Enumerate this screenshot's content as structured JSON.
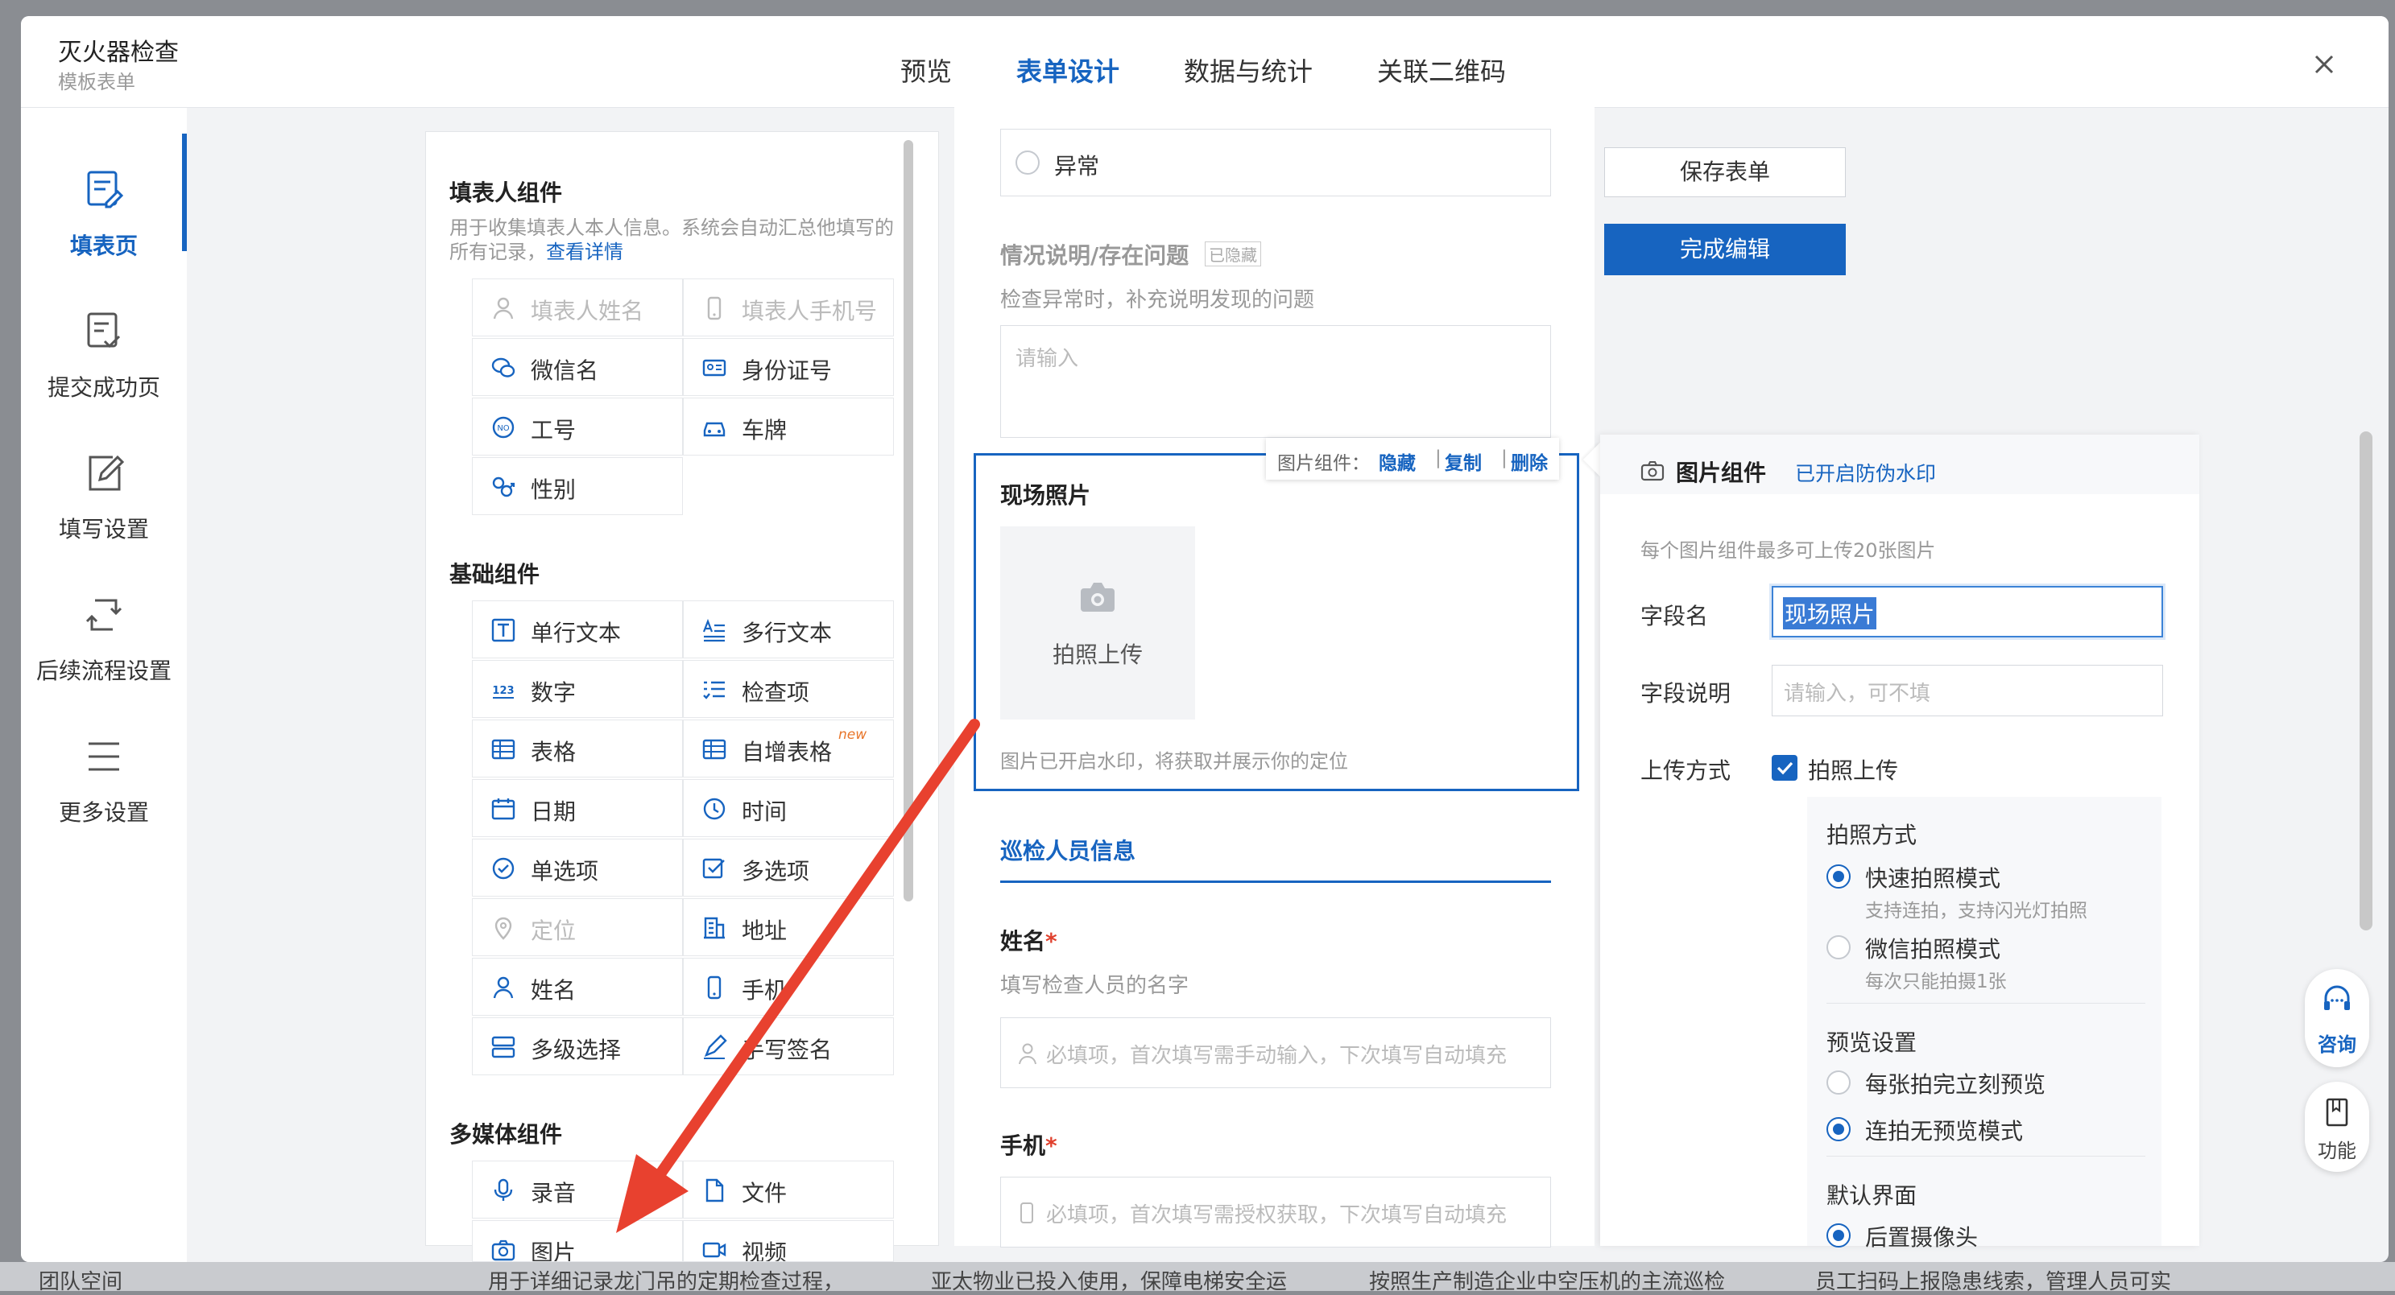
{
  "header": {
    "title": "灭火器检查",
    "subtitle": "模板表单",
    "tabs": [
      {
        "label": "预览",
        "active": false
      },
      {
        "label": "表单设计",
        "active": true
      },
      {
        "label": "数据与统计",
        "active": false
      },
      {
        "label": "关联二维码",
        "active": false
      }
    ],
    "close_icon": "close-icon"
  },
  "sidebar": {
    "items": [
      {
        "label": "填表页",
        "icon": "form-edit-icon",
        "active": true
      },
      {
        "label": "提交成功页",
        "icon": "submit-check-icon",
        "active": false
      },
      {
        "label": "填写设置",
        "icon": "pencil-square-icon",
        "active": false
      },
      {
        "label": "后续流程设置",
        "icon": "workflow-cycle-icon",
        "active": false
      },
      {
        "label": "更多设置",
        "icon": "menu-lines-icon",
        "active": false
      }
    ]
  },
  "palette": {
    "filler": {
      "title": "填表人组件",
      "desc": "用于收集填表人本人信息。系统会自动汇总他填写的所有记录，",
      "link": "查看详情",
      "items": [
        {
          "label": "填表人姓名",
          "disabled": true
        },
        {
          "label": "填表人手机号",
          "disabled": true
        },
        {
          "label": "微信名",
          "disabled": false
        },
        {
          "label": "身份证号",
          "disabled": false
        },
        {
          "label": "工号",
          "disabled": false
        },
        {
          "label": "车牌",
          "disabled": false
        },
        {
          "label": "性别",
          "disabled": false
        }
      ]
    },
    "basic": {
      "title": "基础组件",
      "items": [
        {
          "label": "单行文本",
          "disabled": false
        },
        {
          "label": "多行文本",
          "disabled": false
        },
        {
          "label": "数字",
          "disabled": false
        },
        {
          "label": "检查项",
          "disabled": false
        },
        {
          "label": "表格",
          "disabled": false
        },
        {
          "label": "自增表格",
          "disabled": false,
          "badge": "new"
        },
        {
          "label": "日期",
          "disabled": false
        },
        {
          "label": "时间",
          "disabled": false
        },
        {
          "label": "单选项",
          "disabled": false
        },
        {
          "label": "多选项",
          "disabled": false
        },
        {
          "label": "定位",
          "disabled": true
        },
        {
          "label": "地址",
          "disabled": false
        },
        {
          "label": "姓名",
          "disabled": false
        },
        {
          "label": "手机",
          "disabled": false
        },
        {
          "label": "多级选择",
          "disabled": false
        },
        {
          "label": "手写签名",
          "disabled": false
        }
      ]
    },
    "media": {
      "title": "多媒体组件",
      "items": [
        {
          "label": "录音",
          "disabled": false
        },
        {
          "label": "文件",
          "disabled": false
        },
        {
          "label": "图片",
          "disabled": false
        },
        {
          "label": "视频",
          "disabled": false
        }
      ]
    }
  },
  "form": {
    "abnormal_option": "异常",
    "situation": {
      "title": "情况说明/存在问题",
      "hidden_tag": "已隐藏",
      "desc": "检查异常时，补充说明发现的问题",
      "placeholder": "请输入"
    },
    "toolbar": {
      "prefix": "图片组件：",
      "hide": "隐藏",
      "copy": "复制",
      "delete": "删除"
    },
    "photo": {
      "title": "现场照片",
      "upload_label": "拍照上传",
      "watermark_note": "图片已开启水印，将获取并展示你的定位"
    },
    "inspector_section": "巡检人员信息",
    "name": {
      "title": "姓名",
      "required_mark": "*",
      "desc": "填写检查人员的名字",
      "placeholder": "必填项，首次填写需手动输入，下次填写自动填充"
    },
    "phone": {
      "title": "手机",
      "required_mark": "*",
      "placeholder": "必填项，首次填写需授权获取，下次填写自动填充"
    }
  },
  "actions": {
    "save": "保存表单",
    "finish": "完成编辑"
  },
  "props": {
    "title": "图片组件",
    "watermark_status": "已开启防伪水印",
    "limit_note": "每个图片组件最多可上传20张图片",
    "field_name_label": "字段名",
    "field_name_value": "现场照片",
    "field_desc_label": "字段说明",
    "field_desc_placeholder": "请输入，可不填",
    "upload_method_label": "上传方式",
    "upload_method_option": "拍照上传",
    "upload_method_checked": true,
    "shoot_mode": {
      "title": "拍照方式",
      "options": [
        {
          "label": "快速拍照模式",
          "hint": "支持连拍，支持闪光灯拍照",
          "selected": true
        },
        {
          "label": "微信拍照模式",
          "hint": "每次只能拍摄1张",
          "selected": false
        }
      ]
    },
    "preview": {
      "title": "预览设置",
      "options": [
        {
          "label": "每张拍完立刻预览",
          "selected": false
        },
        {
          "label": "连拍无预览模式",
          "selected": true
        }
      ]
    },
    "default_view": {
      "title": "默认界面",
      "options": [
        {
          "label": "后置摄像头",
          "selected": true
        }
      ]
    }
  },
  "floating": {
    "consult": "咨询",
    "function": "功能"
  },
  "background_cards": [
    "用于详细记录龙门吊的定期检查过程，",
    "亚太物业已投入使用，保障电梯安全运",
    "按照生产制造企业中空压机的主流巡检",
    "员工扫码上报隐患线索，管理人员可实"
  ],
  "background_sidebar": "团队空间",
  "colors": {
    "accent": "#1764c0",
    "annotation_arrow": "#e8412f",
    "required": "#e0412e"
  }
}
